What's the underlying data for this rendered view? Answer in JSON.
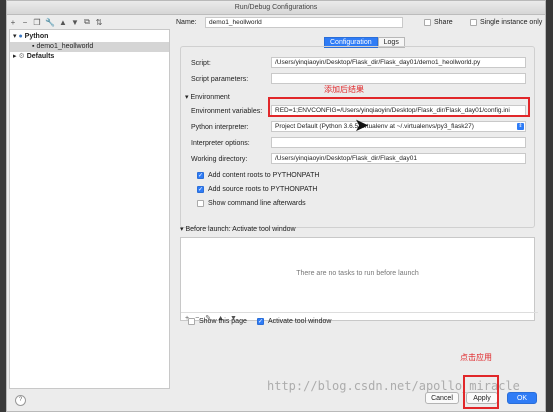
{
  "window": {
    "title": "Run/Debug Configurations"
  },
  "toolbar": {
    "icons": [
      "+",
      "−",
      "❐",
      "🔧",
      "▲",
      "▼",
      "⧉",
      "⇅"
    ]
  },
  "tree": {
    "python_label": "Python",
    "config_label": "demo1_heollworld",
    "defaults_label": "Defaults"
  },
  "form": {
    "name_label": "Name:",
    "name_value": "demo1_heollworld",
    "share_label": "Share",
    "single_instance_label": "Single instance only",
    "tabs": [
      "Configuration",
      "Logs"
    ],
    "script_label": "Script:",
    "script_value": "/Users/yinqiaoyin/Desktop/Flask_dir/Flask_day01/demo1_heollworld.py",
    "script_params_label": "Script parameters:",
    "script_params_value": "",
    "environment_section": "Environment",
    "env_vars_label": "Environment variables:",
    "env_vars_value": "RED=1;ENVCONFIG=/Users/yinqiaoyin/Desktop/Flask_dir/Flask_day01/config.ini",
    "interpreter_label": "Python interpreter:",
    "interpreter_value": "Project Default (Python 3.6.5 virtualenv at ~/.virtualenvs/py3_flask27)",
    "interpreter_options_label": "Interpreter options:",
    "interpreter_options_value": "",
    "working_dir_label": "Working directory:",
    "working_dir_value": "/Users/yinqiaoyin/Desktop/Flask_dir/Flask_day01",
    "add_content_roots_label": "Add content roots to PYTHONPATH",
    "add_source_roots_label": "Add source roots to PYTHONPATH",
    "show_command_line_label": "Show command line afterwards"
  },
  "before_launch": {
    "title": "Before launch: Activate tool window",
    "empty_text": "There are no tasks to run before launch",
    "tools": [
      "+",
      "−",
      "✎",
      "▲",
      "▼"
    ],
    "show_page_label": "Show this page",
    "activate_tool_label": "Activate tool window"
  },
  "annotations": {
    "env_note": "添加后结果",
    "apply_note": "点击应用"
  },
  "buttons": {
    "cancel": "Cancel",
    "apply": "Apply",
    "ok": "OK",
    "help": "?"
  },
  "watermark": "http://blog.csdn.net/apollo_miracle",
  "colors": {
    "accent": "#2f7cf6",
    "annotation": "#e1272a"
  }
}
